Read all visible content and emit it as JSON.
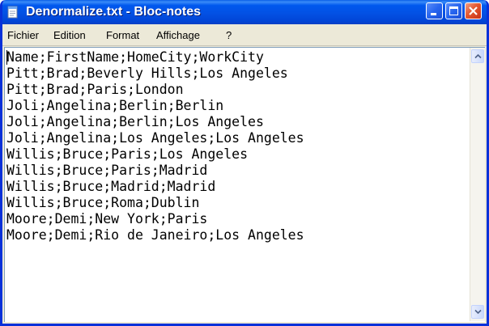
{
  "window": {
    "title": "Denormalize.txt - Bloc-notes",
    "accent": "#0058ee",
    "close_color": "#e4572f"
  },
  "menu": {
    "items": [
      {
        "label": "Fichier"
      },
      {
        "label": "Edition"
      },
      {
        "label": "Format"
      },
      {
        "label": "Affichage"
      },
      {
        "label": "?"
      }
    ]
  },
  "editor": {
    "content": "Name;FirstName;HomeCity;WorkCity\nPitt;Brad;Beverly Hills;Los Angeles\nPitt;Brad;Paris;London\nJoli;Angelina;Berlin;Berlin\nJoli;Angelina;Berlin;Los Angeles\nJoli;Angelina;Los Angeles;Los Angeles\nWillis;Bruce;Paris;Los Angeles\nWillis;Bruce;Paris;Madrid\nWillis;Bruce;Madrid;Madrid\nWillis;Bruce;Roma;Dublin\nMoore;Demi;New York;Paris\nMoore;Demi;Rio de Janeiro;Los Angeles"
  },
  "icons": {
    "app": "notepad-icon",
    "minimize": "minimize-icon",
    "maximize": "maximize-icon",
    "close": "close-icon",
    "scroll_up": "chevron-up-icon",
    "scroll_down": "chevron-down-icon"
  }
}
